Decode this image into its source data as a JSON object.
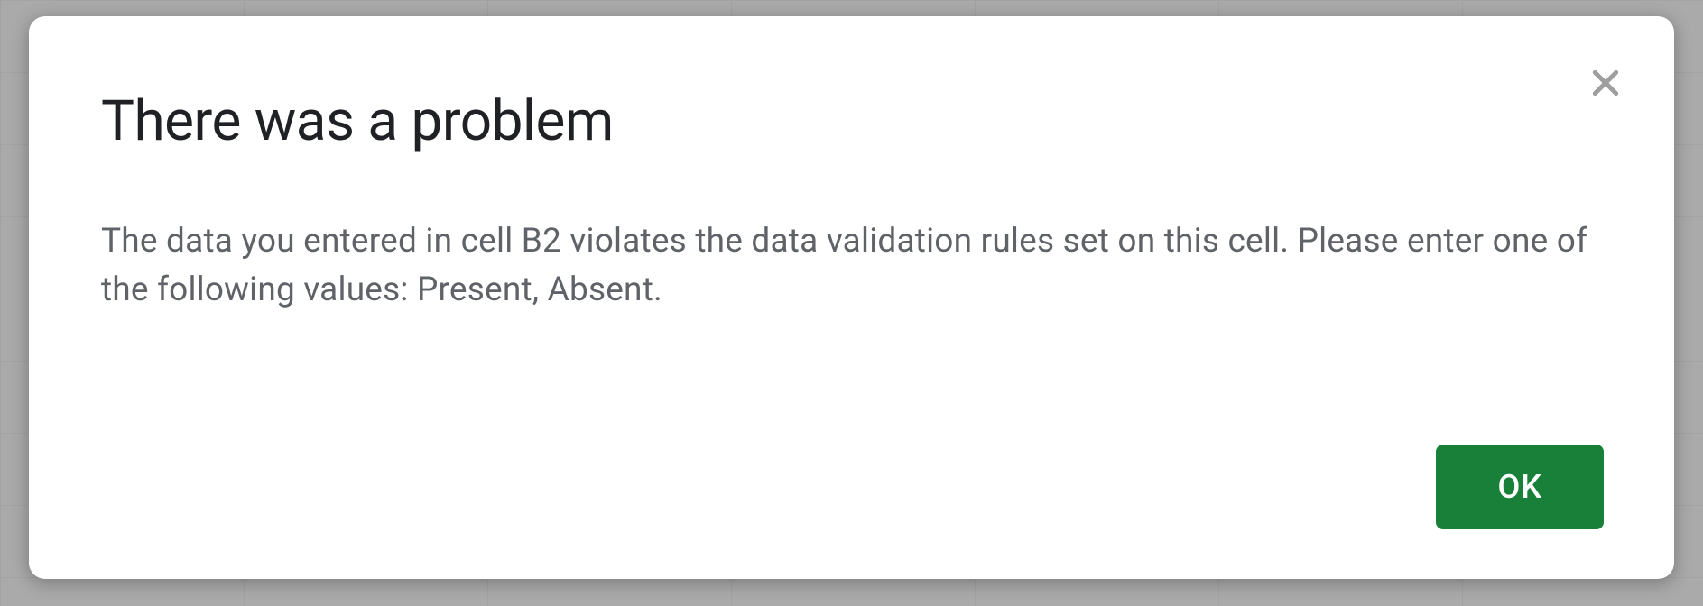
{
  "dialog": {
    "title": "There was a problem",
    "message": "The data you entered in cell B2 violates the data validation rules set on this cell. Please enter one of the following values: Present, Absent.",
    "ok_label": "OK"
  }
}
